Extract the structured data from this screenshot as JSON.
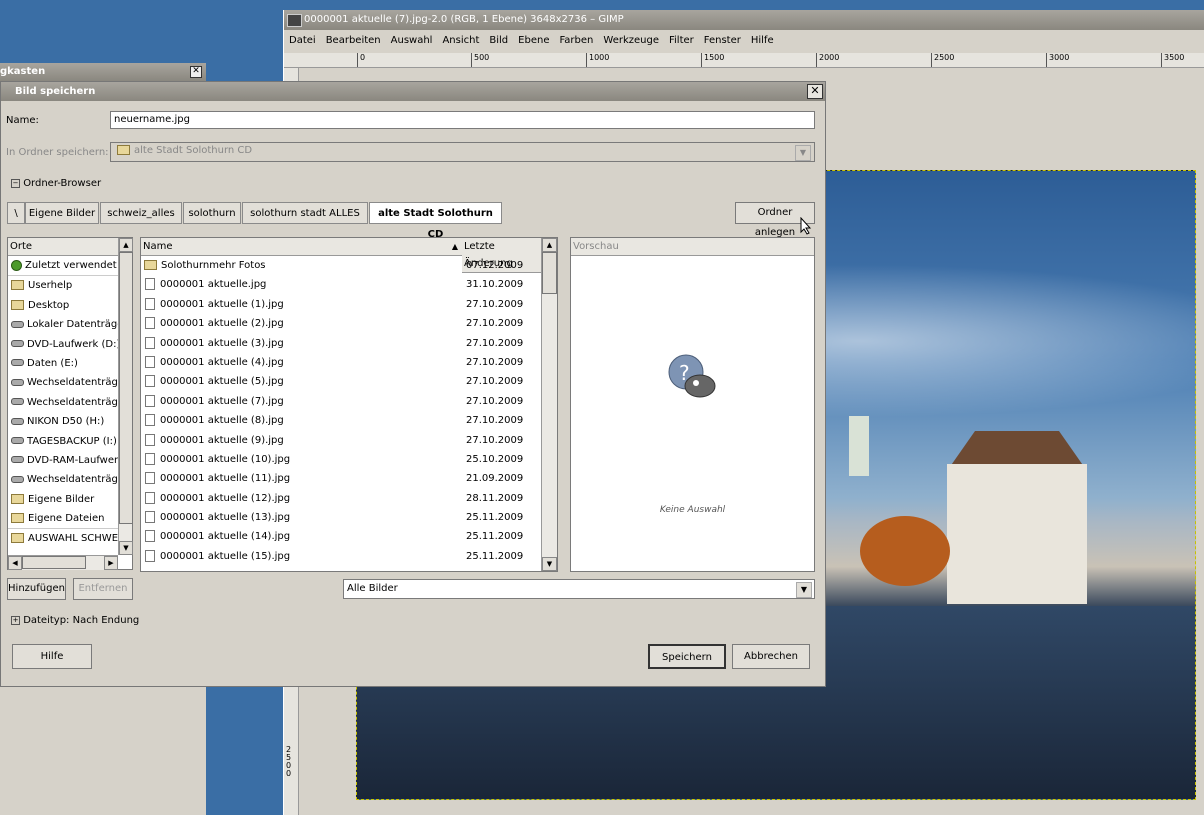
{
  "gimp": {
    "title": "0000001 aktuelle (7).jpg-2.0 (RGB, 1 Ebene) 3648x2736 – GIMP",
    "menu": [
      "Datei",
      "Bearbeiten",
      "Auswahl",
      "Ansicht",
      "Bild",
      "Ebene",
      "Farben",
      "Werkzeuge",
      "Filter",
      "Fenster",
      "Hilfe"
    ],
    "ruler_labels": [
      "0",
      "500",
      "1000",
      "1500",
      "2000",
      "2500",
      "3000",
      "3500"
    ],
    "vruler_label": "2500"
  },
  "toolbox": {
    "title": "gkasten",
    "close": "✕"
  },
  "dialog": {
    "title": "Bild speichern",
    "close": "✕",
    "name_label": "Name:",
    "name_value": "neuername.jpg",
    "folder_label": "In Ordner speichern:",
    "folder_value": "alte Stadt Solothurn CD",
    "browser_toggle": "Ordner-Browser",
    "crumbs": [
      "\\",
      "Eigene Bilder",
      "schweiz_alles",
      "solothurn",
      "solothurn stadt ALLES",
      "alte Stadt Solothurn CD"
    ],
    "new_folder": "Ordner anlegen",
    "places_header": "Orte",
    "places": [
      {
        "icon": "recent",
        "label": "Zuletzt verwendet"
      },
      {
        "icon": "folder",
        "label": "Userhelp"
      },
      {
        "icon": "folder",
        "label": "Desktop"
      },
      {
        "icon": "drive",
        "label": "Lokaler Datenträger"
      },
      {
        "icon": "drive",
        "label": "DVD-Laufwerk (D:)"
      },
      {
        "icon": "drive",
        "label": "Daten (E:)"
      },
      {
        "icon": "drive",
        "label": "Wechseldatenträger"
      },
      {
        "icon": "drive",
        "label": "Wechseldatenträger"
      },
      {
        "icon": "drive",
        "label": "NIKON D50 (H:)"
      },
      {
        "icon": "drive",
        "label": "TAGESBACKUP (I:)"
      },
      {
        "icon": "drive",
        "label": "DVD-RAM-Laufwerk ("
      },
      {
        "icon": "drive",
        "label": "Wechseldatenträger"
      },
      {
        "icon": "folder",
        "label": "Eigene Bilder"
      },
      {
        "icon": "folder",
        "label": "Eigene Dateien"
      },
      {
        "icon": "folder",
        "label": "AUSWAHL SCHWEIZ"
      }
    ],
    "files_header_name": "Name",
    "files_header_date": "Letzte Änderung",
    "files": [
      {
        "icon": "folder",
        "name": "Solothurnmehr Fotos",
        "date": "07.12.2009"
      },
      {
        "icon": "file",
        "name": "0000001 aktuelle.jpg",
        "date": "31.10.2009"
      },
      {
        "icon": "file",
        "name": "0000001 aktuelle (1).jpg",
        "date": "27.10.2009"
      },
      {
        "icon": "file",
        "name": "0000001 aktuelle (2).jpg",
        "date": "27.10.2009"
      },
      {
        "icon": "file",
        "name": "0000001 aktuelle (3).jpg",
        "date": "27.10.2009"
      },
      {
        "icon": "file",
        "name": "0000001 aktuelle (4).jpg",
        "date": "27.10.2009"
      },
      {
        "icon": "file",
        "name": "0000001 aktuelle (5).jpg",
        "date": "27.10.2009"
      },
      {
        "icon": "file",
        "name": "0000001 aktuelle (7).jpg",
        "date": "27.10.2009"
      },
      {
        "icon": "file",
        "name": "0000001 aktuelle (8).jpg",
        "date": "27.10.2009"
      },
      {
        "icon": "file",
        "name": "0000001 aktuelle (9).jpg",
        "date": "27.10.2009"
      },
      {
        "icon": "file",
        "name": "0000001 aktuelle (10).jpg",
        "date": "25.10.2009"
      },
      {
        "icon": "file",
        "name": "0000001 aktuelle (11).jpg",
        "date": "21.09.2009"
      },
      {
        "icon": "file",
        "name": "0000001 aktuelle (12).jpg",
        "date": "28.11.2009"
      },
      {
        "icon": "file",
        "name": "0000001 aktuelle (13).jpg",
        "date": "25.11.2009"
      },
      {
        "icon": "file",
        "name": "0000001 aktuelle (14).jpg",
        "date": "25.11.2009"
      },
      {
        "icon": "file",
        "name": "0000001 aktuelle (15).jpg",
        "date": "25.11.2009"
      }
    ],
    "preview_header": "Vorschau",
    "preview_empty": "Keine Auswahl",
    "add_button": "Hinzufügen",
    "remove_button": "Entfernen",
    "filter_value": "Alle Bilder",
    "filetype_toggle": "Dateityp: Nach Endung",
    "help_button": "Hilfe",
    "save_button": "Speichern",
    "cancel_button": "Abbrechen"
  }
}
